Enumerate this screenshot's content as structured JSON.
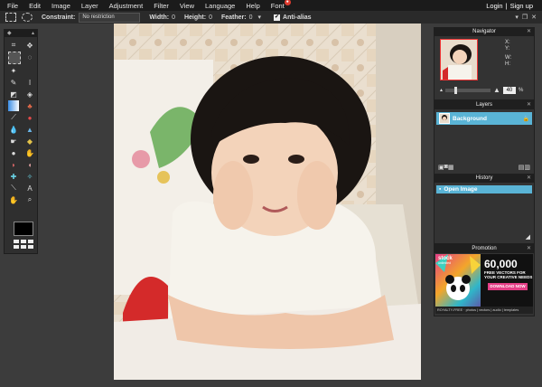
{
  "menu": {
    "items": [
      {
        "label": "File"
      },
      {
        "label": "Edit"
      },
      {
        "label": "Image"
      },
      {
        "label": "Layer"
      },
      {
        "label": "Adjustment"
      },
      {
        "label": "Filter"
      },
      {
        "label": "View"
      },
      {
        "label": "Language"
      },
      {
        "label": "Help"
      },
      {
        "label": "Font"
      }
    ],
    "login": "Login",
    "separator": "|",
    "signup": "Sign up"
  },
  "options": {
    "constraint_label": "Constraint:",
    "constraint_value": "No restriction",
    "width_label": "Width:",
    "width_value": "0",
    "height_label": "Height:",
    "height_value": "0",
    "feather_label": "Feather:",
    "feather_value": "0",
    "antialias_label": "Anti-alias",
    "antialias_checked": true
  },
  "navigator": {
    "title": "Navigator",
    "x_label": "X:",
    "y_label": "Y:",
    "w_label": "W:",
    "h_label": "H:",
    "zoom_value": "40",
    "zoom_unit": "%"
  },
  "layers": {
    "title": "Layers",
    "items": [
      {
        "name": "Background"
      }
    ]
  },
  "history": {
    "title": "History",
    "items": [
      {
        "name": "Open Image"
      }
    ]
  },
  "promotion": {
    "title": "Promotion",
    "brand": "stock",
    "brand_sub": "unlimited",
    "headline": "60,000",
    "subline": "FREE VECTORS FOR YOUR CREATIVE NEEDS",
    "cta": "DOWNLOAD NOW",
    "footer": "ROYALTY-FREE · photos | vectors | audio | templates"
  },
  "colors": {
    "menubar": "#1b1b1b",
    "panel_accent": "#5ab4d6",
    "workspace": "#3c3c3c"
  }
}
